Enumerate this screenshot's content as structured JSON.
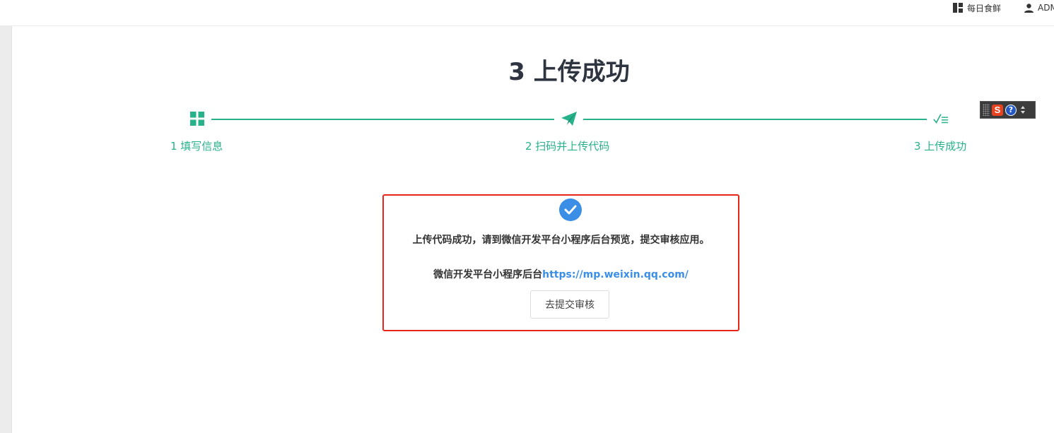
{
  "header": {
    "shop_label": "每日食鲜",
    "user_label": "ADM",
    "shop_icon": "grid-icon",
    "user_icon": "user-icon"
  },
  "title": "3 上传成功",
  "steps": [
    {
      "label": "1 填写信息",
      "icon": "grid-icon"
    },
    {
      "label": "2 扫码并上传代码",
      "icon": "paper-plane-icon"
    },
    {
      "label": "3 上传成功",
      "icon": "check-list-icon"
    }
  ],
  "success": {
    "message": "上传代码成功，请到微信开发平台小程序后台预览，提交审核应用。",
    "link_prefix": "微信开发平台小程序后台",
    "link_url": "https://mp.weixin.qq.com/",
    "button_label": "去提交审核"
  },
  "colors": {
    "accent": "#28b28b",
    "link": "#3a8ee6",
    "highlight_border": "#e7251b",
    "title": "#2f3540"
  }
}
